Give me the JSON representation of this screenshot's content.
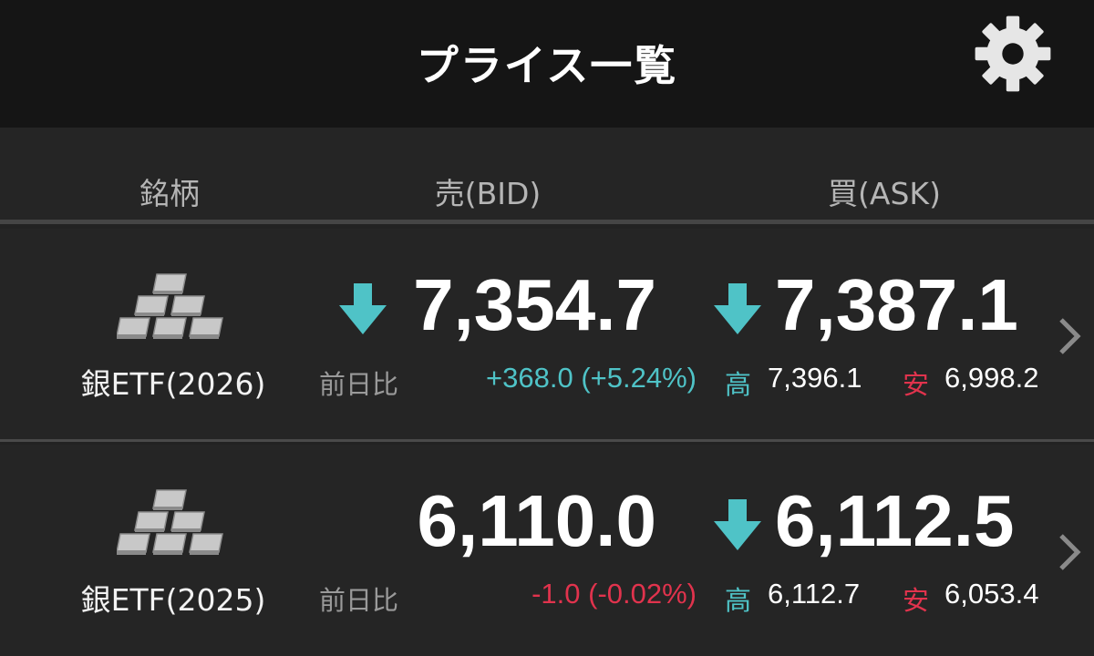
{
  "header": {
    "title": "プライス一覧",
    "settings_icon": "gear-icon"
  },
  "columns": {
    "name": "銘柄",
    "bid": "売(BID)",
    "ask": "買(ASK)"
  },
  "colors": {
    "up": "#4fc3c7",
    "down": "#e1334d",
    "background": "#252525",
    "header_bg": "#151515"
  },
  "rows": [
    {
      "name": "銀ETF(2026)",
      "icon": "silver-bars-icon",
      "bid": "7,354.7",
      "bid_direction": "down",
      "ask": "7,387.1",
      "ask_direction": "down",
      "prev_label": "前日比",
      "change": "+368.0 (+5.24%)",
      "change_direction": "up",
      "high_label": "高",
      "high": "7,396.1",
      "low_label": "安",
      "low": "6,998.2"
    },
    {
      "name": "銀ETF(2025)",
      "icon": "silver-bars-icon",
      "bid": "6,110.0",
      "bid_direction": "none",
      "ask": "6,112.5",
      "ask_direction": "down",
      "prev_label": "前日比",
      "change": "-1.0 (-0.02%)",
      "change_direction": "down",
      "high_label": "高",
      "high": "6,112.7",
      "low_label": "安",
      "low": "6,053.4"
    }
  ]
}
